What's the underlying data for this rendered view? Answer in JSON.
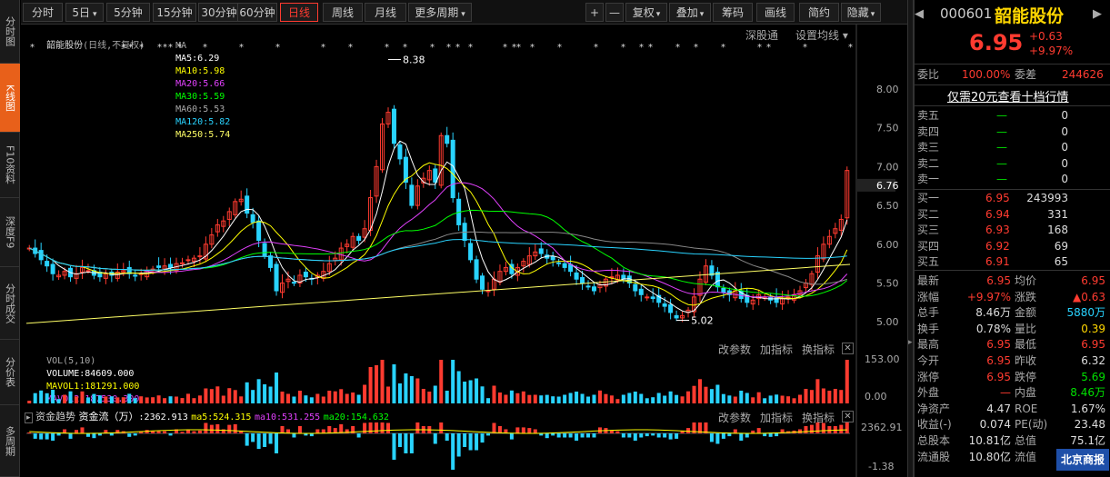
{
  "nav": {
    "left": [
      "分时图",
      "K线图",
      "F10资料",
      "深度F9",
      "分时成交",
      "分价表",
      "多周期"
    ],
    "active_index": 1
  },
  "toolbar": {
    "periods": [
      "分时",
      "5日",
      "5分钟",
      "15分钟",
      "30分钟",
      "60分钟",
      "日线",
      "周线",
      "月线",
      "更多周期"
    ],
    "active": "日线",
    "tools": [
      "复权",
      "叠加",
      "筹码",
      "画线",
      "简约",
      "隐藏"
    ],
    "plus": "+",
    "minus": "—"
  },
  "main_legend": {
    "name": "韶能股份",
    "mode": "(日线,不复权)",
    "ma_label": "MA",
    "ma5": "MA5:6.29",
    "ma10": "MA10:5.98",
    "ma20": "MA20:5.66",
    "ma30": "MA30:5.59",
    "ma60": "MA60:5.53",
    "ma120": "MA120:5.82",
    "ma250": "MA250:5.74",
    "shengutong": "深股通",
    "settings": "设置均线",
    "high_marker": "8.38",
    "low_marker": "5.02",
    "current_tag": "6.76"
  },
  "vol_legend": {
    "title": "VOL(5,10)",
    "volume": "VOLUME:84609.000",
    "mavol1": "MAVOL1:181291.000",
    "mavol2": "MAVOL2:187530.300",
    "btn_params": "改参数",
    "btn_add": "加指标",
    "btn_switch": "换指标",
    "top_tick": "153.00",
    "bottom_tick": "0.00"
  },
  "fund_legend": {
    "tab1": "资金趋势",
    "tab2": "资金流（万）",
    "value": ":2362.913",
    "ma5": "ma5:524.315",
    "ma10": "ma10:531.255",
    "ma20": "ma20:154.632",
    "btn_params": "改参数",
    "btn_add": "加指标",
    "btn_switch": "换指标",
    "top_tick": "2362.91",
    "bottom_tick": "-1.38"
  },
  "stock": {
    "code": "000601",
    "name": "韶能股份",
    "price": "6.95",
    "change": "+0.63",
    "change_pct": "+9.97%",
    "weibi_label": "委比",
    "weibi": "100.00%",
    "weicha_label": "委差",
    "weicha": "244626",
    "promo": "仅需20元查看十档行情"
  },
  "asks": [
    {
      "label": "卖五",
      "price": "—",
      "vol": "0"
    },
    {
      "label": "卖四",
      "price": "—",
      "vol": "0"
    },
    {
      "label": "卖三",
      "price": "—",
      "vol": "0"
    },
    {
      "label": "卖二",
      "price": "—",
      "vol": "0"
    },
    {
      "label": "卖一",
      "price": "—",
      "vol": "0"
    }
  ],
  "bids": [
    {
      "label": "买一",
      "price": "6.95",
      "vol": "243993"
    },
    {
      "label": "买二",
      "price": "6.94",
      "vol": "331"
    },
    {
      "label": "买三",
      "price": "6.93",
      "vol": "168"
    },
    {
      "label": "买四",
      "price": "6.92",
      "vol": "69"
    },
    {
      "label": "买五",
      "price": "6.91",
      "vol": "65"
    }
  ],
  "stats": [
    {
      "l1": "最新",
      "v1": "6.95",
      "c1": "red",
      "l2": "均价",
      "v2": "6.95",
      "c2": "red"
    },
    {
      "l1": "涨幅",
      "v1": "+9.97%",
      "c1": "red",
      "l2": "涨跌",
      "v2": "▲0.63",
      "c2": "red"
    },
    {
      "l1": "总手",
      "v1": "8.46万",
      "c1": "white",
      "l2": "金额",
      "v2": "5880万",
      "c2": "cyan"
    },
    {
      "l1": "换手",
      "v1": "0.78%",
      "c1": "white",
      "l2": "量比",
      "v2": "0.39",
      "c2": "yellow"
    },
    {
      "l1": "最高",
      "v1": "6.95",
      "c1": "red",
      "l2": "最低",
      "v2": "6.95",
      "c2": "red"
    },
    {
      "l1": "今开",
      "v1": "6.95",
      "c1": "red",
      "l2": "昨收",
      "v2": "6.32",
      "c2": "white"
    },
    {
      "l1": "涨停",
      "v1": "6.95",
      "c1": "red",
      "l2": "跌停",
      "v2": "5.69",
      "c2": "green"
    },
    {
      "l1": "外盘",
      "v1": "—",
      "c1": "red",
      "l2": "内盘",
      "v2": "8.46万",
      "c2": "green"
    },
    {
      "l1": "净资产",
      "v1": "4.47",
      "c1": "white",
      "l2": "ROE",
      "v2": "1.67%",
      "c2": "white"
    },
    {
      "l1": "收益(-)",
      "v1": "0.074",
      "c1": "white",
      "l2": "PE(动)",
      "v2": "23.48",
      "c2": "white"
    },
    {
      "l1": "总股本",
      "v1": "10.81亿",
      "c1": "white",
      "l2": "总值",
      "v2": "75.1亿",
      "c2": "white"
    },
    {
      "l1": "流通股",
      "v1": "10.80亿",
      "c1": "white",
      "l2": "流值",
      "v2": "",
      "c2": "white"
    }
  ],
  "watermark": "北京商报",
  "colors": {
    "up": "#ff3b30",
    "down": "#29d3ff",
    "ma5": "#ffffff",
    "ma10": "#ffff00",
    "ma20": "#e040fb",
    "ma30": "#00ff00",
    "ma60": "#888888",
    "ma120": "#29d3ff",
    "ma250": "#ffff66"
  },
  "chart_data": {
    "type": "candlestick",
    "y_ticks": [
      "8.00",
      "7.50",
      "7.00",
      "6.50",
      "6.00",
      "5.50",
      "5.00"
    ],
    "ylim": [
      4.85,
      8.48
    ],
    "close": [
      5.95,
      5.88,
      5.8,
      5.72,
      5.62,
      5.6,
      5.65,
      5.58,
      5.62,
      5.7,
      5.66,
      5.6,
      5.58,
      5.62,
      5.6,
      5.64,
      5.66,
      5.62,
      5.6,
      5.62,
      5.66,
      5.68,
      5.7,
      5.72,
      5.7,
      5.75,
      5.76,
      5.8,
      5.82,
      5.85,
      6.0,
      6.12,
      6.25,
      6.3,
      6.42,
      6.55,
      6.58,
      6.4,
      6.28,
      6.05,
      5.85,
      5.7,
      5.4,
      5.5,
      5.55,
      5.5,
      5.6,
      5.58,
      5.55,
      5.6,
      5.65,
      5.75,
      5.82,
      5.95,
      6.0,
      6.1,
      6.05,
      6.2,
      6.6,
      7.0,
      7.55,
      7.7,
      7.3,
      7.1,
      6.8,
      6.5,
      6.75,
      6.85,
      6.95,
      6.8,
      7.4,
      7.3,
      6.6,
      6.25,
      6.05,
      5.8,
      5.55,
      5.42,
      5.4,
      5.55,
      5.65,
      5.7,
      5.62,
      5.7,
      5.78,
      5.85,
      5.9,
      5.88,
      5.82,
      5.8,
      5.75,
      5.7,
      5.65,
      5.55,
      5.5,
      5.45,
      5.4,
      5.48,
      5.55,
      5.58,
      5.6,
      5.55,
      5.5,
      5.4,
      5.35,
      5.32,
      5.3,
      5.25,
      5.2,
      5.12,
      5.05,
      5.08,
      5.15,
      5.32,
      5.55,
      5.72,
      5.6,
      5.45,
      5.38,
      5.35,
      5.4,
      5.3,
      5.25,
      5.28,
      5.35,
      5.32,
      5.28,
      5.25,
      5.3,
      5.32,
      5.35,
      5.4,
      5.5,
      5.62,
      5.85,
      6.0,
      6.1,
      6.2,
      6.32,
      6.95
    ],
    "ma_last": {
      "ma5": 6.29,
      "ma10": 5.98,
      "ma20": 5.66,
      "ma30": 5.59,
      "ma60": 5.53,
      "ma120": 5.82,
      "ma250": 5.74
    }
  }
}
